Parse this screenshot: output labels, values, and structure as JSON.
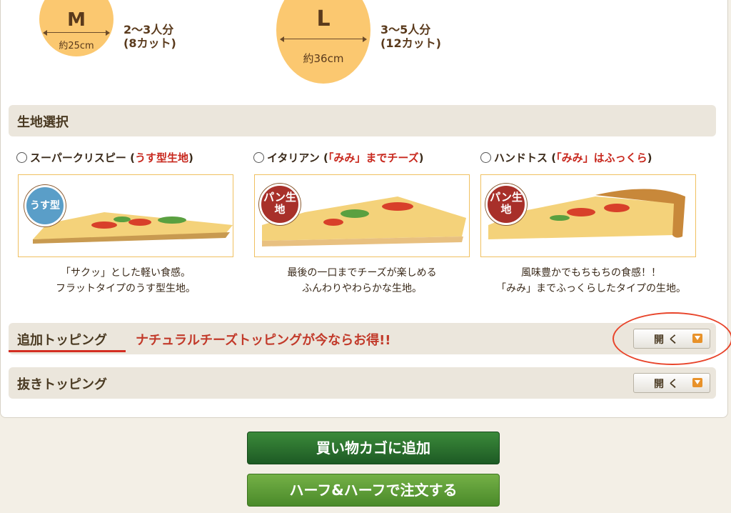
{
  "sizes": [
    {
      "letter": "M",
      "diameter": "約25cm",
      "serves": "2〜3人分",
      "cuts": "(8カット)"
    },
    {
      "letter": "L",
      "diameter": "約36cm",
      "serves": "3〜5人分",
      "cuts": "(12カット)"
    }
  ],
  "dough": {
    "title": "生地選択",
    "options": [
      {
        "name": "スーパークリスピー (",
        "highlight": "うす型生地",
        "close": ")",
        "badge": "うす型",
        "desc1": "「サクッ」とした軽い食感。",
        "desc2": "フラットタイプのうす型生地。"
      },
      {
        "name": "イタリアン (",
        "highlight": "「みみ」までチーズ",
        "close": ")",
        "badge": "パン生地",
        "desc1": "最後の一口までチーズが楽しめる",
        "desc2": "ふんわりやわらかな生地。"
      },
      {
        "name": "ハンドトス (",
        "highlight": "「みみ」はふっくら",
        "close": ")",
        "badge": "パン生地",
        "desc1": "風味豊かでもちもちの食感！！",
        "desc2": "「みみ」までふっくらしたタイプの生地。"
      }
    ]
  },
  "extra_topping": {
    "title": "追加トッピング",
    "promo": "ナチュラルチーズトッピングが今ならお得!!",
    "open_label": "開く"
  },
  "remove_topping": {
    "title": "抜きトッピング",
    "open_label": "開く"
  },
  "actions": {
    "add_to_cart": "買い物カゴに追加",
    "half_and_half": "ハーフ&ハーフで注文する"
  },
  "colors": {
    "accent_red": "#c8281e",
    "circle": "#fbc870",
    "cart_green": "#2a6e2e",
    "half_green": "#5e9e38"
  }
}
